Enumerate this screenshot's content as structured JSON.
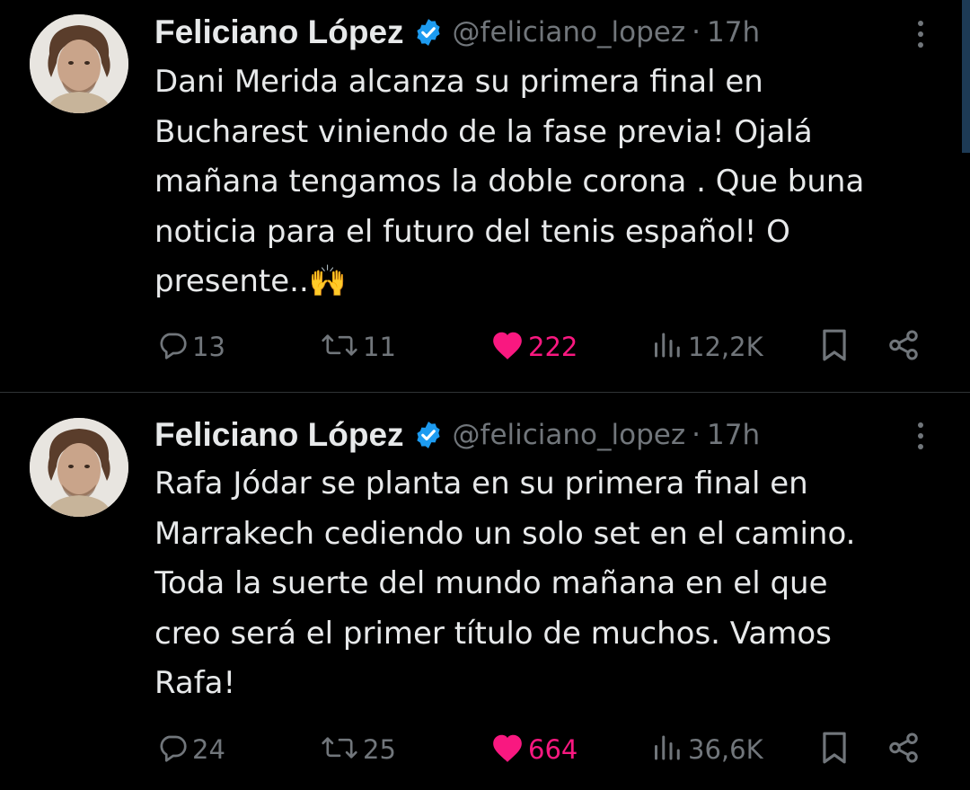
{
  "colors": {
    "background": "#000000",
    "text_primary": "#e7e9ea",
    "text_secondary": "#71767b",
    "like_active": "#f91880",
    "verified": "#1d9bf0",
    "divider": "#2f3336"
  },
  "tweets": [
    {
      "author_name": "Feliciano López",
      "verified": true,
      "handle": "@feliciano_lopez",
      "separator": "·",
      "time": "17h",
      "text": "Dani Merida alcanza su primera final en\nBucharest viniendo de la fase previa! Ojalá\nmañana tengamos la doble corona . Que buna\nnoticia para el futuro del tenis español! O\npresente..🙌",
      "reply_count": "13",
      "repost_count": "11",
      "like_count": "222",
      "like_active": true,
      "view_count": "12,2K",
      "icons": [
        "avatar",
        "verified-badge-icon",
        "more-icon",
        "reply-icon",
        "repost-icon",
        "heart-icon",
        "views-icon",
        "bookmark-icon",
        "share-icon"
      ]
    },
    {
      "author_name": "Feliciano López",
      "verified": true,
      "handle": "@feliciano_lopez",
      "separator": "·",
      "time": "17h",
      "text": "Rafa Jódar se planta en su primera final  en\nMarrakech cediendo un solo set en el camino.\nToda la suerte del mundo mañana  en el que\ncreo será el primer título de muchos. Vamos\nRafa!",
      "reply_count": "24",
      "repost_count": "25",
      "like_count": "664",
      "like_active": true,
      "view_count": "36,6K",
      "icons": [
        "avatar",
        "verified-badge-icon",
        "more-icon",
        "reply-icon",
        "repost-icon",
        "heart-icon",
        "views-icon",
        "bookmark-icon",
        "share-icon"
      ]
    }
  ]
}
